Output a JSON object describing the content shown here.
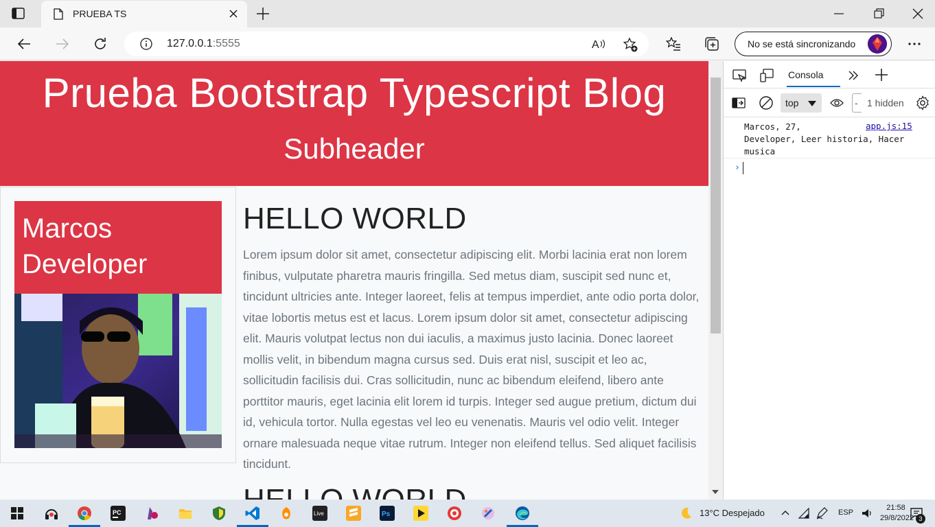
{
  "browser": {
    "tab_title": "PRUEBA TS",
    "url_host": "127.0.0.1",
    "url_port": ":5555",
    "sync_label": "No se está sincronizando"
  },
  "page": {
    "hero_title": "Prueba Bootstrap Typescript Blog",
    "hero_subtitle": "Subheader",
    "profile_line1": "Marcos",
    "profile_line2": "Developer",
    "article_title": "HELLO WORLD",
    "article_body": "Lorem ipsum dolor sit amet, consectetur adipiscing elit. Morbi lacinia erat non lorem finibus, vulputate pharetra mauris fringilla. Sed metus diam, suscipit sed nunc et, tincidunt ultricies ante. Integer laoreet, felis at tempus imperdiet, ante odio porta dolor, vitae lobortis metus est et lacus. Lorem ipsum dolor sit amet, consectetur adipiscing elit. Mauris volutpat lectus non dui iaculis, a maximus justo lacinia. Donec laoreet mollis velit, in bibendum magna cursus sed. Duis erat nisl, suscipit et leo ac, sollicitudin facilisis dui. Cras sollicitudin, nunc ac bibendum eleifend, libero ante porttitor mauris, eget lacinia elit lorem id turpis. Integer sed augue pretium, dictum dui id, vehicula tortor. Nulla egestas vel leo eu venenatis. Mauris vel odio velit. Integer ornare malesuada neque vitae rutrum. Integer non eleifend tellus. Sed aliquet facilisis tincidunt.",
    "article_title_2": "HELLO WORLD"
  },
  "devtools": {
    "tab_label": "Consola",
    "context": "top",
    "filter_text": "-",
    "hidden": "1 hidden",
    "log_text": "Marcos, 27,\nDeveloper, Leer historia, Hacer\nmusica",
    "log_source": "app.js:15",
    "prompt_symbol": "›"
  },
  "taskbar": {
    "weather": "13°C  Despejado",
    "language": "ESP",
    "time": "21:58",
    "date": "29/8/2022",
    "notifications": "3"
  },
  "colors": {
    "accent": "#dc3545",
    "edge_blue": "#0067c0"
  }
}
